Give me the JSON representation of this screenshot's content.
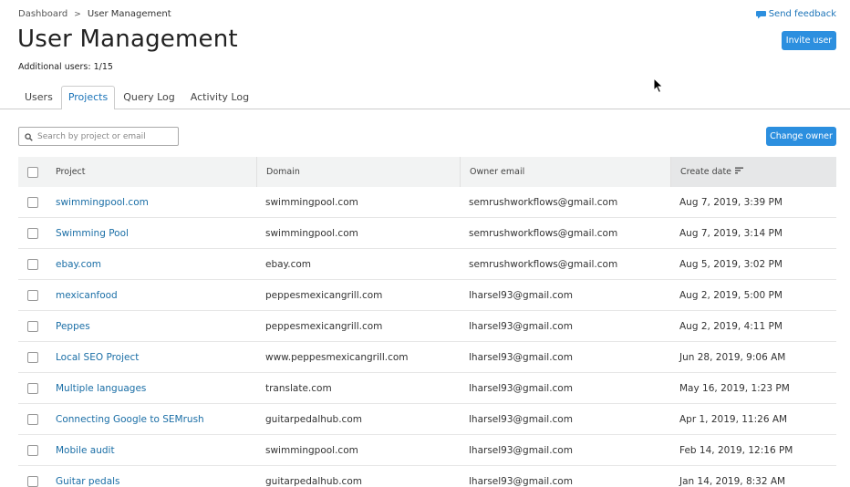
{
  "breadcrumb": {
    "parent": "Dashboard",
    "separator": ">",
    "current": "User Management"
  },
  "feedback": {
    "label": "Send feedback",
    "icon": "chat-bubble-icon"
  },
  "page": {
    "title": "User Management",
    "additional_users": "Additional users: 1/15"
  },
  "header": {
    "invite_label": "Invite user"
  },
  "tabs": [
    {
      "label": "Users",
      "active": false
    },
    {
      "label": "Projects",
      "active": true
    },
    {
      "label": "Query Log",
      "active": false
    },
    {
      "label": "Activity Log",
      "active": false
    }
  ],
  "search": {
    "placeholder": "Search by project or email",
    "value": "",
    "icon": "search-icon"
  },
  "toolbar": {
    "change_owner_label": "Change owner"
  },
  "table": {
    "columns": [
      "Project",
      "Domain",
      "Owner email",
      "Create date"
    ],
    "sorted_column": "Create date",
    "rows": [
      {
        "project": "swimmingpool.com",
        "domain": "swimmingpool.com",
        "owner": "semrushworkflows@gmail.com",
        "date": "Aug 7, 2019, 3:39 PM"
      },
      {
        "project": "Swimming Pool",
        "domain": "swimmingpool.com",
        "owner": "semrushworkflows@gmail.com",
        "date": "Aug 7, 2019, 3:14 PM"
      },
      {
        "project": "ebay.com",
        "domain": "ebay.com",
        "owner": "semrushworkflows@gmail.com",
        "date": "Aug 5, 2019, 3:02 PM"
      },
      {
        "project": "mexicanfood",
        "domain": "peppesmexicangrill.com",
        "owner": "lharsel93@gmail.com",
        "date": "Aug 2, 2019, 5:00 PM"
      },
      {
        "project": "Peppes",
        "domain": "peppesmexicangrill.com",
        "owner": "lharsel93@gmail.com",
        "date": "Aug 2, 2019, 4:11 PM"
      },
      {
        "project": "Local SEO Project",
        "domain": "www.peppesmexicangrill.com",
        "owner": "lharsel93@gmail.com",
        "date": "Jun 28, 2019, 9:06 AM"
      },
      {
        "project": "Multiple languages",
        "domain": "translate.com",
        "owner": "lharsel93@gmail.com",
        "date": "May 16, 2019, 1:23 PM"
      },
      {
        "project": "Connecting Google to SEMrush",
        "domain": "guitarpedalhub.com",
        "owner": "lharsel93@gmail.com",
        "date": "Apr 1, 2019, 11:26 AM"
      },
      {
        "project": "Mobile audit",
        "domain": "swimmingpool.com",
        "owner": "lharsel93@gmail.com",
        "date": "Feb 14, 2019, 12:16 PM"
      },
      {
        "project": "Guitar pedals",
        "domain": "guitarpedalhub.com",
        "owner": "lharsel93@gmail.com",
        "date": "Jan 14, 2019, 8:32 AM"
      }
    ]
  },
  "colors": {
    "accent": "#2c8fdf",
    "link": "#1a6ea6",
    "header_bg": "#f2f3f3"
  }
}
